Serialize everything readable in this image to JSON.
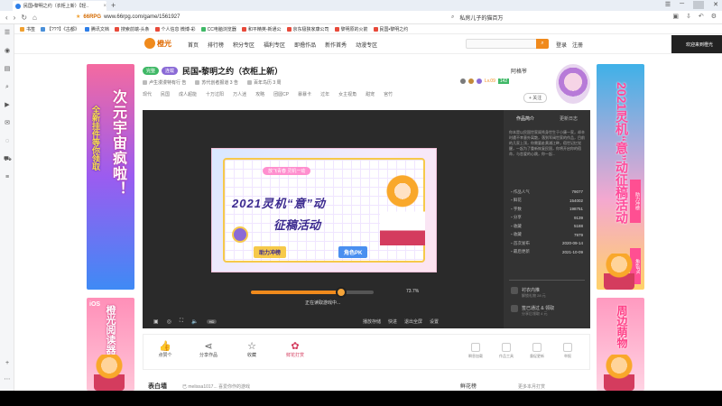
{
  "browser": {
    "tab_title": "民国•黎明之约（衣柜上新）【轻..",
    "url_host": "66RPG",
    "url_path": "www.66rpg.com/game/1561927",
    "search_text": "私房儿子的猫百万",
    "bookmarks": [
      "书签",
      "【???】《古都》",
      "腾讯文档",
      "搜索前端-头条",
      "个人信息 微博-彩",
      "CC电脑浏览器",
      "和平精英-新通公",
      "京东极狭家康公司",
      "黎明原的火箭",
      "民国•黎明之约"
    ]
  },
  "site": {
    "logo": "橙光",
    "nav": [
      "首页",
      "排行榜",
      "积分专区",
      "福利专区",
      "即撸作品",
      "新作首秀",
      "动漫专区"
    ],
    "login": "登录",
    "register": "注册",
    "top_ad": "欢迎来到橙光"
  },
  "work": {
    "tag_green": "完整",
    "tag_purple": "连载",
    "title": "民国•黎明之约（衣柜上新）",
    "author_line": [
      "卢生漫漫特有行 告",
      "苏代创者报道 3 告",
      "百年鸟历 3 周"
    ],
    "tags": [
      "现代",
      "民国",
      "成人超能",
      "十万过阳",
      "万人迷",
      "攻略",
      "团圆CP",
      "暴暴卡",
      "过年",
      "女主视角",
      "甜宠",
      "宫竹"
    ],
    "author_name": "阿格爷",
    "level": "Lv.09",
    "fav_count": "142",
    "follow": "+ 关注"
  },
  "player": {
    "ribbon": "放飞青春 灵机一动",
    "headline1": "2021灵机“意”动",
    "headline2": "征稿活动",
    "btn_a": "助力冲榜",
    "btn_b": "角色PK",
    "progress_pct": 0.737,
    "progress_label": "73.7%",
    "loading_msg": "正在读取游戏中...",
    "hd_label": "HD",
    "controls_right": [
      "播放存储",
      "快进",
      "退出全屏",
      "设置"
    ]
  },
  "info": {
    "tabs": [
      "作品简介",
      "更新日志"
    ],
    "desc": "你本是以民国世家闺秀身世生于小康一家，却辛时遭不幸意外离散，落到军阀世家的作品，目前的几家上顶，你需要赴黄浦江畔，宿世记忆觉醒，一起为了重新恢复民国，你将开启你的宿命，与恋爱的心跳，你一起...",
    "stats": [
      {
        "k": "作品人气",
        "v": "79077"
      },
      {
        "k": "鲜花",
        "v": "154002"
      },
      {
        "k": "字数",
        "v": "198751"
      },
      {
        "k": "分享",
        "v": "9139"
      },
      {
        "k": "收藏",
        "v": "5188"
      },
      {
        "k": "收藏",
        "v": "7979"
      },
      {
        "k": "首次发布",
        "v": "2020-09-14"
      },
      {
        "k": "最后更新",
        "v": "2021-10-09"
      }
    ],
    "action1": "衬衣内推",
    "action1_sub": "解锁礼物 28 元",
    "action2": "签已通过 & 领取",
    "action2_sub": "分享后领取 4 元"
  },
  "actions": {
    "like": "点赞个",
    "share": "分享作品",
    "collect": "收藏",
    "rose": "鲜花打赏",
    "small": [
      "瞬息加载",
      "作品工具",
      "督促更新",
      "举报"
    ]
  },
  "footer": {
    "t1": "表白墙",
    "t2": "已 melissa1017... 喜爱你作的游戏",
    "t3": "鲜花榜",
    "t4": "更多本月打赏"
  },
  "ads": {
    "left1_a": "次元宇宙疯啦！",
    "left1_b": "全新挂件等你领取",
    "left2_ios": "iOS",
    "left2": "橙光阅读器上架啦",
    "right1": "2021灵机“意”动征稿活动",
    "right1_tag1": "助力冲榜",
    "right1_tag2": "角色PK",
    "right2": "周边萌物"
  }
}
